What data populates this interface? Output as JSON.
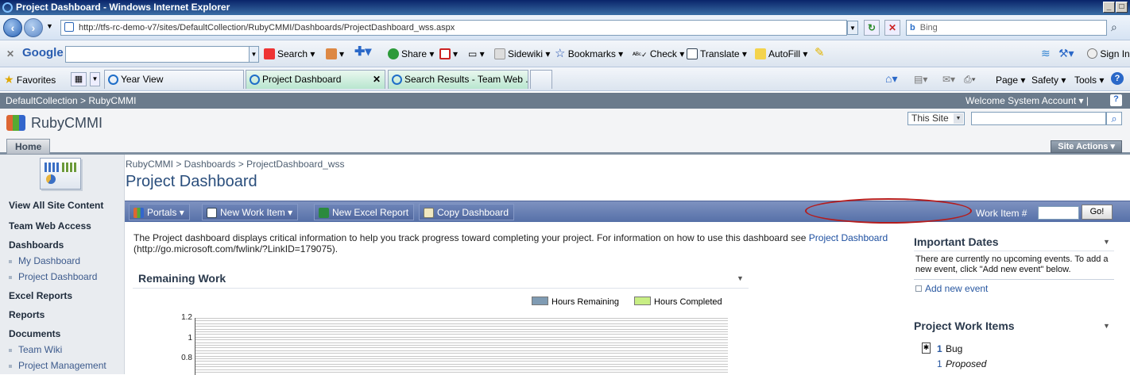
{
  "window": {
    "title": "Project Dashboard - Windows Internet Explorer"
  },
  "address": {
    "url": "http://tfs-rc-demo-v7/sites/DefaultCollection/RubyCMMI/Dashboards/ProjectDashboard_wss.aspx",
    "search_placeholder": "Bing"
  },
  "google_toolbar": {
    "brand": "Google",
    "search_label": "Search",
    "share_label": "Share",
    "sidewiki_label": "Sidewiki",
    "bookmarks_label": "Bookmarks",
    "check_label": "Check",
    "translate_label": "Translate",
    "autofill_label": "AutoFill",
    "signin_label": "Sign In"
  },
  "favorites_bar": {
    "favorites_label": "Favorites",
    "tabs": [
      {
        "label": "Year View"
      },
      {
        "label": "Project Dashboard"
      },
      {
        "label": "Search Results - Team Web ..."
      }
    ],
    "page_menu": "Page",
    "safety_menu": "Safety",
    "tools_menu": "Tools"
  },
  "sharepoint": {
    "top_breadcrumb": "DefaultCollection > RubyCMMI",
    "welcome": "Welcome System Account",
    "site_name": "RubyCMMI",
    "scope_select": "This Site",
    "home_tab": "Home",
    "site_actions": "Site Actions"
  },
  "leftnav": {
    "view_all": "View All Site Content",
    "team_web_access": "Team Web Access",
    "dashboards_heading": "Dashboards",
    "dashboards": [
      "My Dashboard",
      "Project Dashboard"
    ],
    "excel_reports": "Excel Reports",
    "reports": "Reports",
    "documents_heading": "Documents",
    "documents": [
      "Team Wiki",
      "Project Management"
    ]
  },
  "page": {
    "breadcrumb": "RubyCMMI > Dashboards > ProjectDashboard_wss",
    "title": "Project Dashboard",
    "toolbar": {
      "portals": "Portals",
      "new_work_item": "New Work Item",
      "new_excel_report": "New Excel Report",
      "copy_dashboard": "Copy Dashboard",
      "work_item_label": "Work Item #",
      "go_button": "Go!"
    },
    "description_prefix": "The Project dashboard displays critical information to help you track progress toward completing your project. For information on how to use this dashboard see ",
    "description_link": "Project Dashboard",
    "description_suffix": " (http://go.microsoft.com/fwlink/?LinkID=179075)."
  },
  "remaining_work": {
    "title": "Remaining Work"
  },
  "chart_data": {
    "type": "area",
    "series": [
      {
        "name": "Hours Remaining",
        "color": "#7f9bb3",
        "values": []
      },
      {
        "name": "Hours Completed",
        "color": "#c8ee84",
        "values": []
      }
    ],
    "y_ticks": [
      "1.2",
      "1",
      "0.8"
    ],
    "ylim": [
      0.8,
      1.2
    ],
    "grid": true,
    "legend": "top-right"
  },
  "important_dates": {
    "title": "Important Dates",
    "empty_text": "There are currently no upcoming events. To add a new event, click \"Add new event\" below.",
    "add_link": "Add new event"
  },
  "project_work_items": {
    "title": "Project Work Items",
    "bug_count": "1",
    "bug_label": "Bug",
    "proposed_count": "1",
    "proposed_label": "Proposed"
  }
}
